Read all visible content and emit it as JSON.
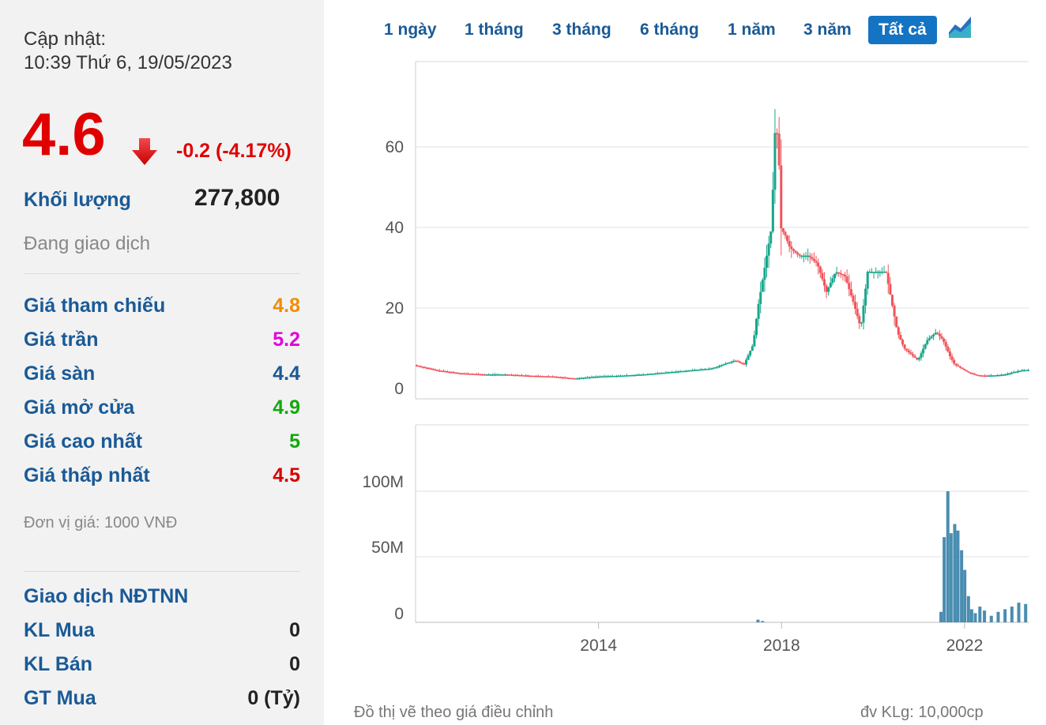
{
  "update": {
    "label": "Cập nhật:",
    "time": "10:39 Thứ 6, 19/05/2023"
  },
  "quote": {
    "price": "4.6",
    "change": "-0.2 (-4.17%)",
    "volume_label": "Khối lượng",
    "volume_value": "277,800",
    "status": "Đang giao dịch"
  },
  "prices": [
    {
      "label": "Giá tham chiếu",
      "value": "4.8",
      "color": "#f28c00"
    },
    {
      "label": "Giá trần",
      "value": "5.2",
      "color": "#e100e1"
    },
    {
      "label": "Giá sàn",
      "value": "4.4",
      "color": "#1a5a96"
    },
    {
      "label": "Giá mở cửa",
      "value": "4.9",
      "color": "#13a80e"
    },
    {
      "label": "Giá cao nhất",
      "value": "5",
      "color": "#13a80e"
    },
    {
      "label": "Giá thấp nhất",
      "value": "4.5",
      "color": "#d80000"
    }
  ],
  "unit_note": "Đơn vị giá: 1000 VNĐ",
  "foreign": {
    "title": "Giao dịch NĐTNN",
    "rows": [
      {
        "label": "KL Mua",
        "value": "0"
      },
      {
        "label": "KL Bán",
        "value": "0"
      },
      {
        "label": "GT Mua",
        "value": "0 (Tỷ)"
      }
    ]
  },
  "tabs": [
    {
      "label": "1 ngày",
      "active": false
    },
    {
      "label": "1 tháng",
      "active": false
    },
    {
      "label": "3 tháng",
      "active": false
    },
    {
      "label": "6 tháng",
      "active": false
    },
    {
      "label": "1 năm",
      "active": false
    },
    {
      "label": "3 năm",
      "active": false
    },
    {
      "label": "Tất cả",
      "active": true
    }
  ],
  "chart_icon": "area-chart-icon",
  "colors": {
    "up": "#17a68b",
    "down": "#f0545c",
    "volume": "#4a8db0",
    "accent": "#1473c2"
  },
  "chart_data": [
    {
      "type": "candlestick",
      "title": "",
      "x_range": [
        2010.0,
        2023.4
      ],
      "y_range": [
        0,
        75
      ],
      "y_ticks": [
        "0",
        "20",
        "40",
        "60"
      ],
      "x_ticks": [
        "2014",
        "2018",
        "2022"
      ],
      "series": [
        {
          "x": [
            2010.0,
            2010.5,
            2011.0,
            2011.5,
            2012.0,
            2012.5,
            2013.0,
            2013.5,
            2014.0,
            2014.5,
            2015.0,
            2015.5,
            2016.0,
            2016.5,
            2017.0,
            2017.2,
            2017.4,
            2017.5,
            2017.65,
            2017.8,
            2017.88,
            2017.95,
            2018.0,
            2018.1,
            2018.2,
            2018.4,
            2018.6,
            2018.8,
            2019.0,
            2019.2,
            2019.4,
            2019.6,
            2019.75,
            2019.9,
            2020.1,
            2020.3,
            2020.45,
            2020.55,
            2020.7,
            2021.0,
            2021.2,
            2021.4,
            2021.55,
            2021.7,
            2021.8,
            2021.95,
            2022.1,
            2022.3,
            2022.5,
            2022.7,
            2022.9,
            2023.1,
            2023.3
          ],
          "values": [
            5.8,
            4.5,
            3.8,
            3.5,
            3.5,
            3.2,
            3.0,
            2.5,
            3.0,
            3.2,
            3.5,
            4.0,
            4.5,
            5.0,
            7.0,
            6.0,
            11.0,
            20.0,
            30.0,
            40.0,
            65.0,
            62.0,
            40.0,
            38.0,
            35.0,
            33.0,
            33.0,
            31.0,
            24.0,
            29.0,
            28.0,
            21.0,
            15.0,
            29.0,
            29.0,
            29.0,
            20.0,
            14.0,
            10.0,
            7.0,
            12.0,
            14.0,
            12.0,
            8.0,
            6.0,
            5.0,
            4.0,
            3.3,
            3.2,
            3.3,
            3.5,
            4.1,
            4.6
          ]
        }
      ]
    },
    {
      "type": "bar",
      "title": "",
      "y_range": [
        0,
        120
      ],
      "y_ticks": [
        "0",
        "50M",
        "100M"
      ],
      "series": [
        {
          "x": [
            2017.45,
            2017.55,
            2021.45,
            2021.52,
            2021.6,
            2021.67,
            2021.75,
            2021.82,
            2021.9,
            2021.97,
            2022.05,
            2022.12,
            2022.2,
            2022.3,
            2022.4,
            2022.55,
            2022.7,
            2022.85,
            2023.0,
            2023.15,
            2023.3
          ],
          "values": [
            2,
            1,
            8,
            65,
            100,
            68,
            75,
            70,
            55,
            40,
            20,
            10,
            7,
            12,
            9,
            5,
            8,
            10,
            12,
            15,
            14
          ]
        }
      ]
    }
  ],
  "footnote_left": "Đồ thị vẽ theo giá điều chỉnh",
  "footnote_right": "đv KLg: 10,000cp"
}
